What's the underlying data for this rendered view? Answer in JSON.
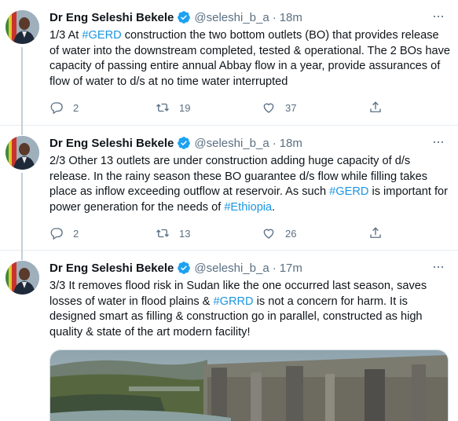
{
  "tweets": [
    {
      "author": "Dr Eng Seleshi Bekele",
      "handle": "@seleshi_b_a",
      "separator": "·",
      "time": "18m",
      "more": "···",
      "text": [
        {
          "t": "1/3 At "
        },
        {
          "t": "#GERD",
          "tag": true
        },
        {
          "t": " construction the two bottom outlets (BO) that provides release of water into the downstream completed, tested & operational. The 2 BOs have capacity of passing entire annual Abbay flow in a year, provide assurances of flow of water to d/s at no time water interrupted"
        }
      ],
      "replies": "2",
      "retweets": "19",
      "likes": "37"
    },
    {
      "author": "Dr Eng Seleshi Bekele",
      "handle": "@seleshi_b_a",
      "separator": "·",
      "time": "18m",
      "more": "···",
      "text": [
        {
          "t": "2/3 Other 13 outlets are under construction adding huge capacity of d/s release. In the rainy season these BO guarantee d/s flow while filling takes place as inflow exceeding outflow at reservoir. As such "
        },
        {
          "t": "#GERD",
          "tag": true
        },
        {
          "t": " is important for power generation for the needs of "
        },
        {
          "t": "#Ethiopia",
          "tag": true
        },
        {
          "t": "."
        }
      ],
      "replies": "2",
      "retweets": "13",
      "likes": "26"
    },
    {
      "author": "Dr Eng Seleshi Bekele",
      "handle": "@seleshi_b_a",
      "separator": "·",
      "time": "17m",
      "more": "···",
      "text": [
        {
          "t": "3/3 It removes flood risk in Sudan like the one occurred last season, saves losses of water in flood plains & "
        },
        {
          "t": "#GRRD",
          "tag": true
        },
        {
          "t": " is not a concern for harm. It is designed smart as filling & construction go in parallel,  constructed as high quality & state of the art modern facility!"
        }
      ]
    }
  ],
  "colors": {
    "link": "#1b95e0",
    "verified": "#1da1f2",
    "muted": "#5b7083",
    "thread": "#c4cfd6"
  },
  "icons": [
    "verified-badge-icon",
    "reply-icon",
    "retweet-icon",
    "like-icon",
    "share-icon",
    "more-icon"
  ]
}
